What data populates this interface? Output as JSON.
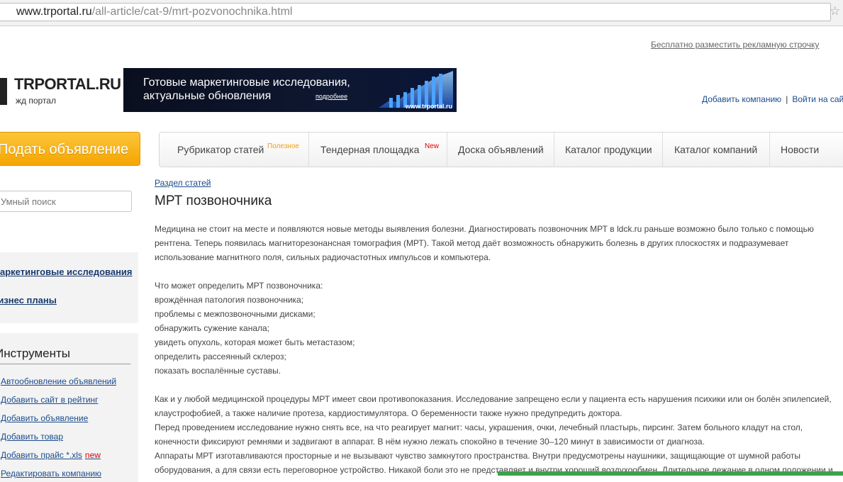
{
  "browser": {
    "url_host": "www.trportal.ru",
    "url_path": "/all-article/cat-9/mrt-pozvonochnika.html"
  },
  "top_ad_link": "Бесплатно разместить рекламную строчку",
  "logo": {
    "title": "TRPORTAL.RU",
    "subtitle": "жд портал"
  },
  "banner": {
    "text": "Готовые маркетинговые исследования, актуальные обновления",
    "more": "подробнее",
    "url": "www.trportal.ru"
  },
  "header_links": {
    "add_company": "Добавить компанию",
    "separator": "|",
    "login": "Войти на сайт"
  },
  "post_button": "Подать объявление",
  "nav": {
    "items": [
      {
        "label": "Рубрикатор статей",
        "tag": "Полезное"
      },
      {
        "label": "Тендерная площадка",
        "tag": "New"
      },
      {
        "label": "Доска объявлений",
        "tag": ""
      },
      {
        "label": "Каталог продукции",
        "tag": ""
      },
      {
        "label": "Каталог компаний",
        "tag": ""
      },
      {
        "label": "Новости",
        "tag": ""
      }
    ]
  },
  "sidebar": {
    "search_placeholder": "Умный поиск",
    "links": [
      "Маркетинговые исследования",
      "Бизнес планы"
    ],
    "tools_title": "Инструменты",
    "tools": [
      {
        "label": "Автообновление объявлений",
        "badge": ""
      },
      {
        "label": "Добавить сайт в рейтинг",
        "badge": ""
      },
      {
        "label": "Добавить объявление",
        "badge": ""
      },
      {
        "label": "Добавить товар",
        "badge": ""
      },
      {
        "label": "Добавить прайс *.xls",
        "badge": "new"
      },
      {
        "label": "Редактировать компанию",
        "badge": ""
      }
    ]
  },
  "article": {
    "breadcrumb": "Раздел статей",
    "title": "МРТ позвоночника",
    "intro": [
      "Медицина не стоит на месте и появляются новые методы выявления болезни. Диагностировать позвоночник МРТ в ldck.ru раньше возможно было только с помощью",
      "рентгена. Теперь появилась магниторезонансная томография (МРТ). Такой метод даёт возможность обнаружить болезнь в других плоскостях и подразумевает",
      "использование магнитного поля, сильных радиочастотных импульсов и компьютера."
    ],
    "list": [
      "Что может определить МРТ позвоночника:",
      "врождённая патология позвоночника;",
      "проблемы с межпозвоночными дисками;",
      "обнаружить сужение канала;",
      "увидеть опухоль, которая может быть метастазом;",
      "определить рассеянный склероз;",
      "показать воспалённые суставы."
    ],
    "contra": [
      "Как и у любой медицинской процедуры МРТ имеет свои противопоказания. Исследование запрещено если у пациента есть нарушения психики или он болён эпилепсией,",
      "клаустрофобией, а также наличие протеза, кардиостимулятора. О беременности также нужно предупредить доктора.",
      "Перед проведением исследование нужно снять все, на что реагирует магнит: часы, украшения, очки, лечебный пластырь, пирсинг. Затем больного кладут на стол,",
      "конечности фиксируют ремнями и задвигают в аппарат. В нём нужно лежать спокойно в течение 30–120 минут в зависимости от диагноза.",
      "Аппараты МРТ изготавливаются просторные и не вызывают чувство замкнутого пространства. Внутри предусмотрены наушники, защищающие от шумной работы",
      "оборудования, а для связи есть переговорное устройство. Никакой боли это не представляет и внутри хороший воздухообмен. Длительное лежание в одном положении и"
    ]
  }
}
